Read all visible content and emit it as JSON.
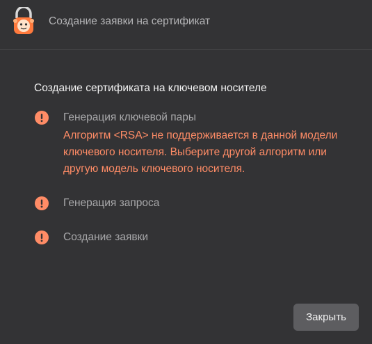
{
  "window": {
    "title": "Создание заявки на сертификат",
    "icon": "padlock-mascot-icon"
  },
  "main": {
    "section_title": "Создание сертификата на ключевом носителе",
    "steps": [
      {
        "label": "Генерация ключевой пары",
        "status": "error",
        "icon": "exclamation-circle-icon",
        "error": "Алгоритм <RSA> не поддерживается в данной модели ключевого носителя. Выберите другой алгоритм или другую модель ключевого носителя."
      },
      {
        "label": "Генерация запроса",
        "status": "error",
        "icon": "exclamation-circle-icon"
      },
      {
        "label": "Создание заявки",
        "status": "error",
        "icon": "exclamation-circle-icon"
      }
    ]
  },
  "footer": {
    "close_label": "Закрыть"
  },
  "colors": {
    "background": "#333335",
    "error_accent": "#ff8c66",
    "button_bg": "#5d5d60"
  }
}
